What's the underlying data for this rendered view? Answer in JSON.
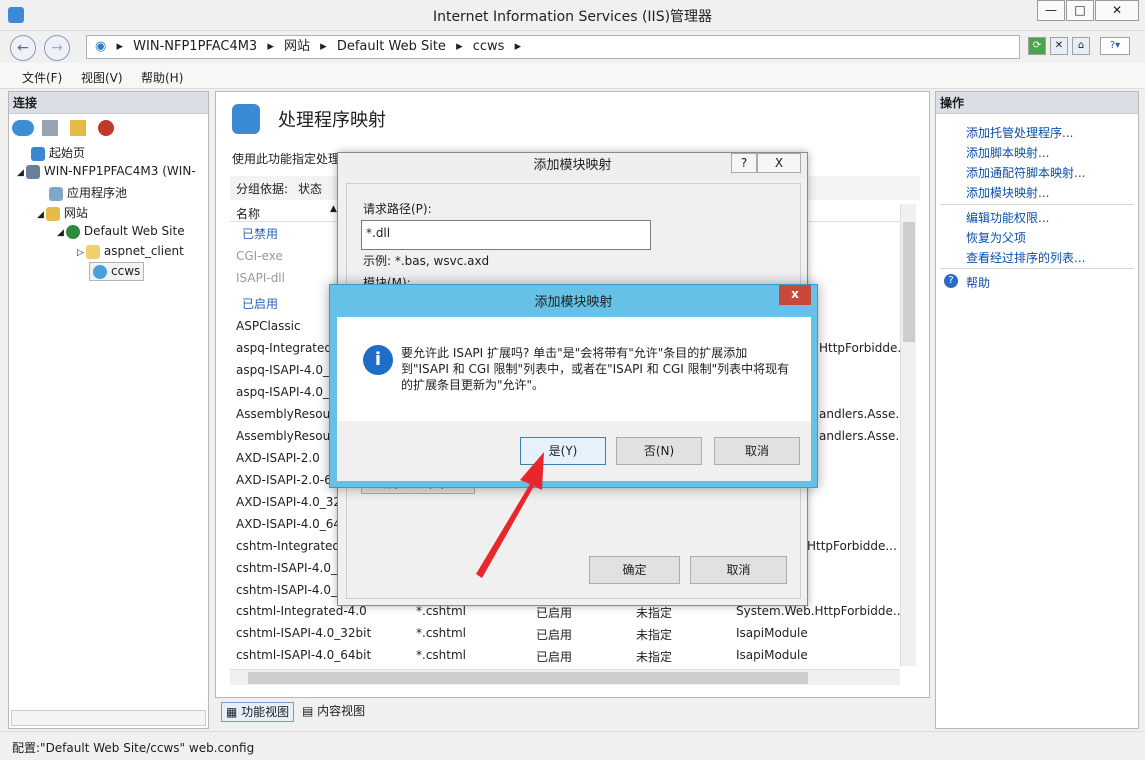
{
  "window": {
    "title": "Internet Information Services (IIS)管理器",
    "min": "—",
    "max": "□",
    "close": "✕"
  },
  "address": {
    "crumbs": [
      "WIN-NFP1PFAC4M3",
      "网站",
      "Default Web Site",
      "ccws"
    ]
  },
  "menu": {
    "file": "文件(F)",
    "view": "视图(V)",
    "help": "帮助(H)"
  },
  "left": {
    "title": "连接",
    "tree": {
      "start": "起始页",
      "server": "WIN-NFP1PFAC4M3 (WIN-",
      "apppool": "应用程序池",
      "sites": "网站",
      "dws": "Default Web Site",
      "aspnet": "aspnet_client",
      "ccws": "ccws"
    }
  },
  "center": {
    "heading": "处理程序映射",
    "desc": "使用此功能指定处理",
    "groupby_label": "分组依据:",
    "groupby_value": "状态",
    "col_name": "名称",
    "group_disabled": "已禁用",
    "group_enabled": "已启用",
    "rows_left": [
      "CGI-exe",
      "ISAPI-dll",
      "ASPClassic",
      "aspq-Integrated",
      "aspq-ISAPI-4.0_3",
      "aspq-ISAPI-4.0_6",
      "AssemblyResour",
      "AssemblyResour",
      "AXD-ISAPI-2.0",
      "AXD-ISAPI-2.0-6",
      "AXD-ISAPI-4.0_32",
      "AXD-ISAPI-4.0_64",
      "cshtm-Integrated-",
      "cshtm-ISAPI-4.0_3",
      "cshtm-ISAPI-4.0_6"
    ],
    "rows_right": [
      "HttpForbidde...",
      "andlers.Asse...",
      "andlers.Asse...",
      "HttpForbidde..."
    ],
    "full_rows": [
      {
        "name": "cshtml-Integrated-4.0",
        "path": "*.cshtml",
        "state": "已启用",
        "type": "未指定",
        "handler": "System.Web.HttpForbidde..."
      },
      {
        "name": "cshtml-ISAPI-4.0_32bit",
        "path": "*.cshtml",
        "state": "已启用",
        "type": "未指定",
        "handler": "IsapiModule"
      },
      {
        "name": "cshtml-ISAPI-4.0_64bit",
        "path": "*.cshtml",
        "state": "已启用",
        "type": "未指定",
        "handler": "IsapiModule"
      }
    ],
    "tab_feature": "功能视图",
    "tab_content": "内容视图"
  },
  "right": {
    "title": "操作",
    "actions": [
      "添加托管处理程序...",
      "添加脚本映射...",
      "添加通配符脚本映射...",
      "添加模块映射..."
    ],
    "actions2": [
      "编辑功能权限...",
      "恢复为父项",
      "查看经过排序的列表..."
    ],
    "help": "帮助"
  },
  "status": "配置:\"Default Web Site/ccws\" web.config",
  "dialog1": {
    "title": "添加模块映射",
    "help": "?",
    "close": "X",
    "path_label": "请求路径(P):",
    "path_value": "*.dll",
    "example": "示例: *.bas, wsvc.axd",
    "module_label": "模块(M):",
    "restrict_button": "请求限制(R)...",
    "ok": "确定",
    "cancel": "取消"
  },
  "dialog2": {
    "title": "添加模块映射",
    "close": "x",
    "message": "要允许此 ISAPI 扩展吗? 单击\"是\"会将带有\"允许\"条目的扩展添加到\"ISAPI 和 CGI 限制\"列表中，或者在\"ISAPI 和 CGI 限制\"列表中将现有的扩展条目更新为\"允许\"。",
    "yes": "是(Y)",
    "no": "否(N)",
    "cancel": "取消",
    "info_glyph": "i"
  }
}
